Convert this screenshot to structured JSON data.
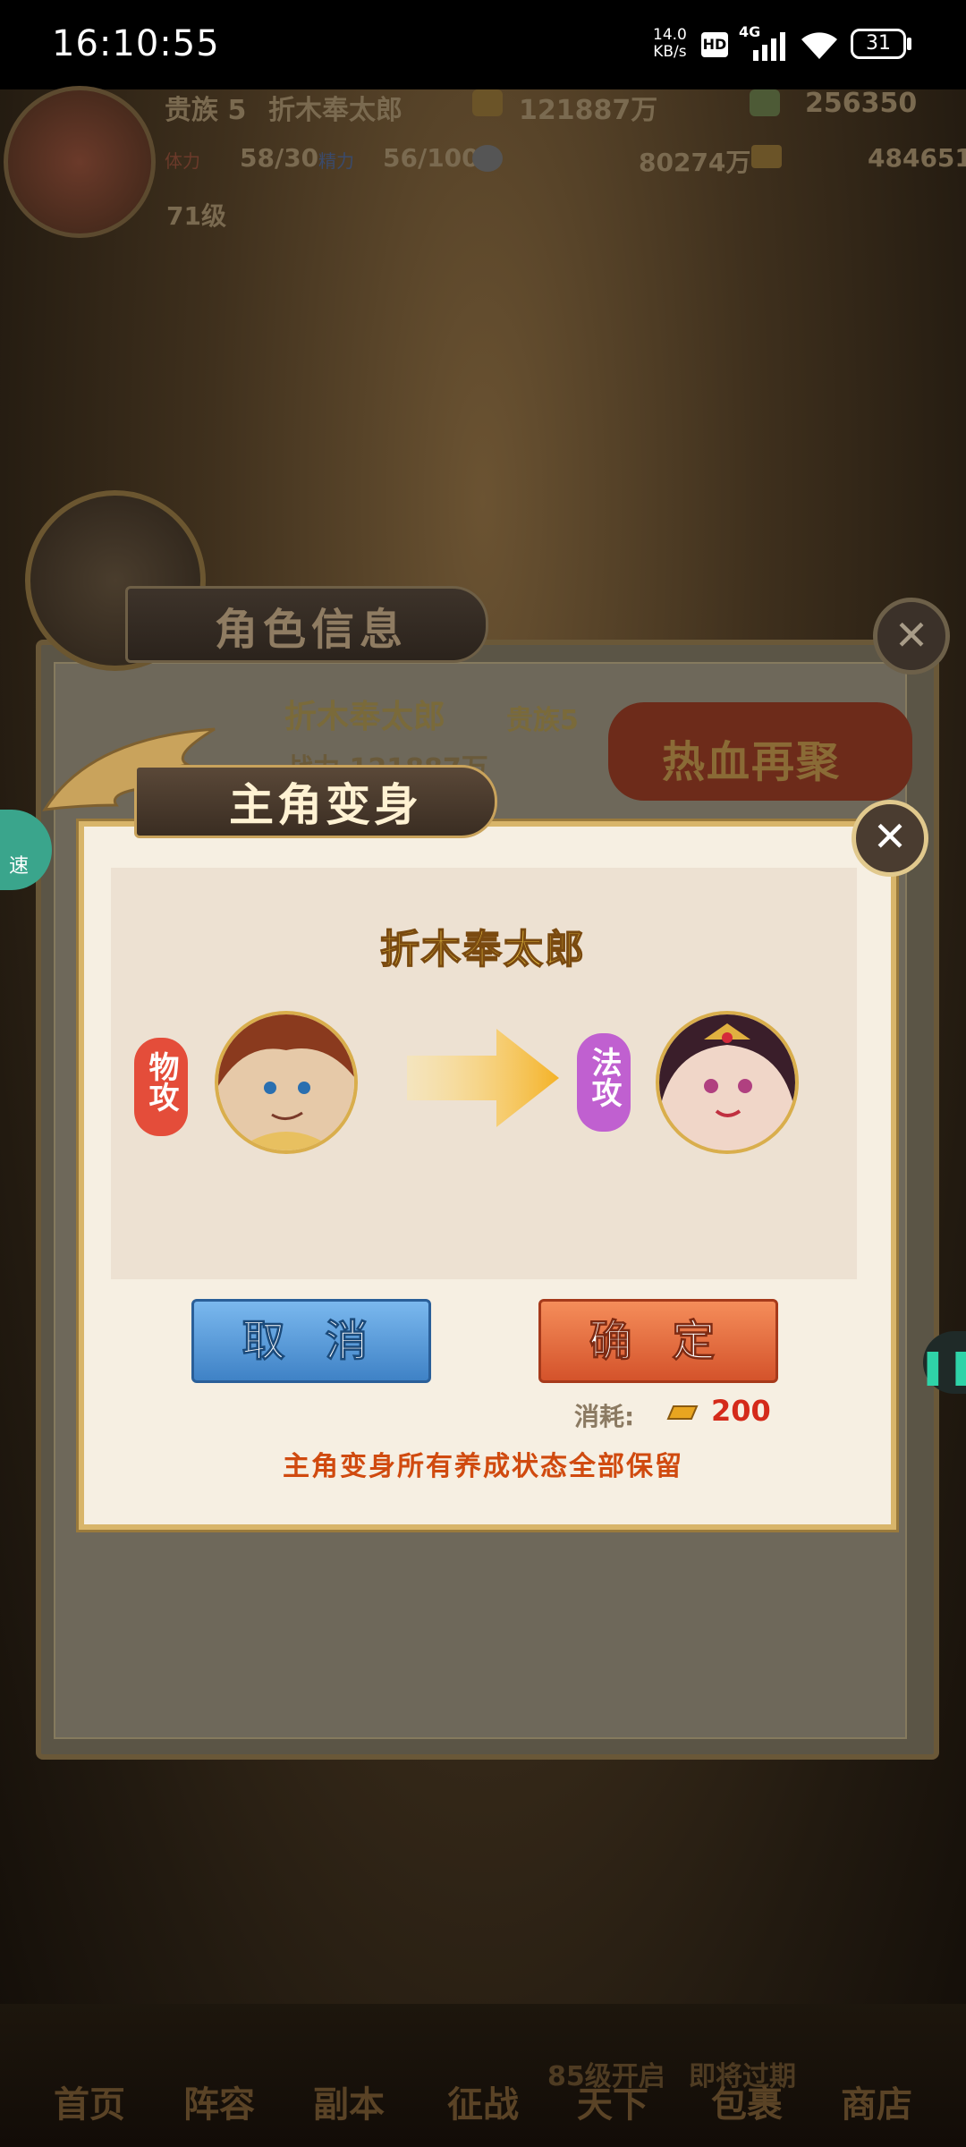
{
  "status_bar": {
    "time": "16:10:55",
    "net_speed_value": "14.0",
    "net_speed_unit": "KB/s",
    "hd_badge": "HD",
    "network": "4G",
    "battery": "31"
  },
  "top_hud": {
    "noble": "贵族 5",
    "player_name": "折木奉太郎",
    "power": "121887万",
    "diamonds": "256350",
    "stamina_label": "体力",
    "stamina": "58/30",
    "energy_label": "精力",
    "energy": "56/100",
    "silver": "80274万",
    "gold": "484651",
    "level": "71级"
  },
  "back_panel": {
    "title": "角色信息",
    "name": "折木奉太郎",
    "noble": "贵族5",
    "power_partial": "战力 121887万",
    "banner": "热血再聚"
  },
  "dialog": {
    "title": "主角变身",
    "hero_name": "折木奉太郎",
    "from_type": "物攻",
    "to_type": "法攻",
    "cancel_label": "取 消",
    "confirm_label": "确 定",
    "cost_label": "消耗:",
    "cost_value": "200",
    "notice": "主角变身所有养成状态全部保留"
  },
  "side": {
    "speed_label": "速"
  },
  "bottom_nav": {
    "items": [
      "首页",
      "阵容",
      "副本",
      "征战",
      "天下",
      "包裹",
      "商店"
    ],
    "badges": [
      "85级开启",
      "即将过期"
    ]
  },
  "colors": {
    "dialog_bg": "#f6efe2",
    "title_gold": "#ffd84a",
    "cancel_blue": "#4a8ed0",
    "confirm_orange": "#e0643a",
    "cost_red": "#d42a1a",
    "notice_orange": "#d04a0f"
  }
}
